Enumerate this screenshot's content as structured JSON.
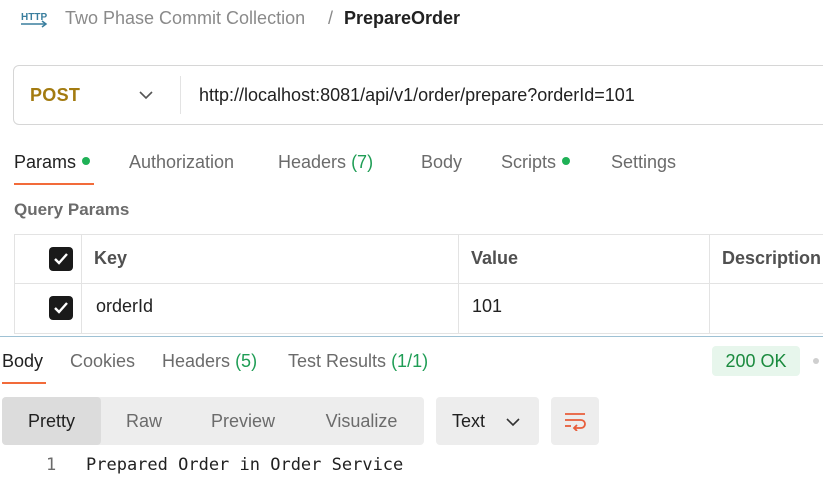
{
  "breadcrumb": {
    "icon_text": "HTTP",
    "collection": "Two Phase Commit Collection",
    "separator": "/",
    "request_name": "PrepareOrder"
  },
  "request": {
    "method": "POST",
    "url": "http://localhost:8081/api/v1/order/prepare?orderId=101"
  },
  "request_tabs": [
    {
      "label": "Params",
      "count": "",
      "dot": true,
      "active": true
    },
    {
      "label": "Authorization",
      "count": "",
      "dot": false,
      "active": false
    },
    {
      "label": "Headers",
      "count": "(7)",
      "dot": false,
      "active": false
    },
    {
      "label": "Body",
      "count": "",
      "dot": false,
      "active": false
    },
    {
      "label": "Scripts",
      "count": "",
      "dot": true,
      "active": false
    },
    {
      "label": "Settings",
      "count": "",
      "dot": false,
      "active": false
    }
  ],
  "query_params": {
    "title": "Query Params",
    "columns": [
      "Key",
      "Value",
      "Description"
    ],
    "rows": [
      {
        "checked": true,
        "key": "orderId",
        "value": "101",
        "description": ""
      }
    ]
  },
  "response_tabs": [
    {
      "label": "Body",
      "count": "",
      "active": true
    },
    {
      "label": "Cookies",
      "count": "",
      "active": false
    },
    {
      "label": "Headers",
      "count": "(5)",
      "active": false
    },
    {
      "label": "Test Results",
      "count": "(1/1)",
      "active": false
    }
  ],
  "status": {
    "text": "200 OK",
    "color": "#1a8a3e"
  },
  "view_modes": [
    "Pretty",
    "Raw",
    "Preview",
    "Visualize"
  ],
  "active_view_mode": "Pretty",
  "format": "Text",
  "response_body": [
    {
      "line": "1",
      "text": "Prepared Order in Order Service"
    }
  ],
  "colors": {
    "accent": "#f26b3a",
    "method_post": "#a37b10",
    "success": "#1fb156"
  }
}
